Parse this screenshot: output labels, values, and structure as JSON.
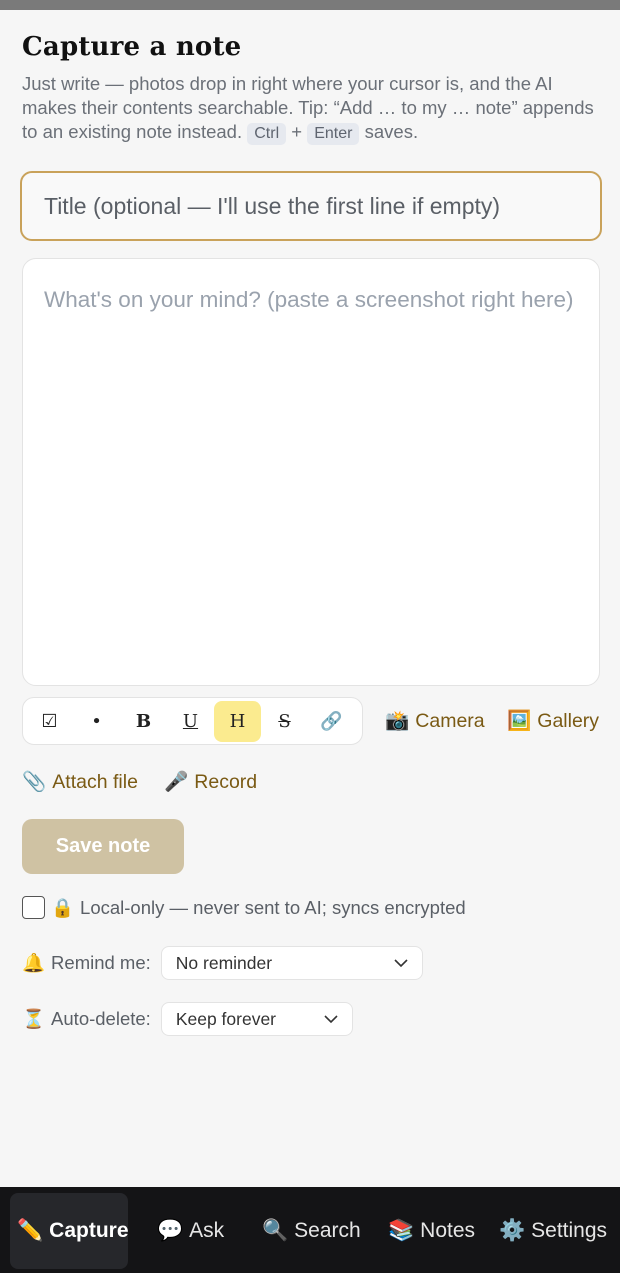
{
  "page": {
    "title": "Capture a note",
    "intro_text": "Just write — photos drop in right where your cursor is, and the AI makes their contents searchable. Tip: “Add … to my … note” appends to an existing note instead.",
    "shortcut_key1": "Ctrl",
    "shortcut_plus": "+",
    "shortcut_key2": "Enter",
    "shortcut_suffix": "saves."
  },
  "title_input": {
    "placeholder": "Title (optional — I'll use the first line if empty)",
    "value": ""
  },
  "body_input": {
    "placeholder": "What's on your mind? (paste a screenshot right here)",
    "value": ""
  },
  "format_toolbar": {
    "checklist": "☑",
    "bullet": "•",
    "bold": "B",
    "underline": "U",
    "highlight": "H",
    "strike": "S",
    "link": "🔗"
  },
  "media": {
    "camera_icon": "📸",
    "camera_label": "Camera",
    "gallery_icon": "🖼️",
    "gallery_label": "Gallery",
    "attach_icon": "📎",
    "attach_label": "Attach file",
    "record_icon": "🎤",
    "record_label": "Record"
  },
  "save_button": {
    "label": "Save note"
  },
  "local_only": {
    "checked": false,
    "icon": "🔒",
    "label": "Local-only — never sent to AI; syncs encrypted"
  },
  "reminder": {
    "icon": "🔔",
    "label": "Remind me:",
    "selected": "No reminder"
  },
  "auto_delete": {
    "icon": "⏳",
    "label": "Auto-delete:",
    "selected": "Keep forever"
  },
  "nav": {
    "capture": {
      "icon": "✏️",
      "label": "Capture"
    },
    "ask": {
      "icon": "💬",
      "label": "Ask"
    },
    "search": {
      "icon": "🔍",
      "label": "Search"
    },
    "notes": {
      "icon": "📚",
      "label": "Notes"
    },
    "settings": {
      "icon": "⚙️",
      "label": "Settings"
    }
  },
  "colors": {
    "accent": "#c9a25a",
    "action_text": "#7a5a14",
    "save_button_bg": "#cfc2a3",
    "highlight_bg": "#fbeb8f",
    "nav_bg": "#141416"
  }
}
